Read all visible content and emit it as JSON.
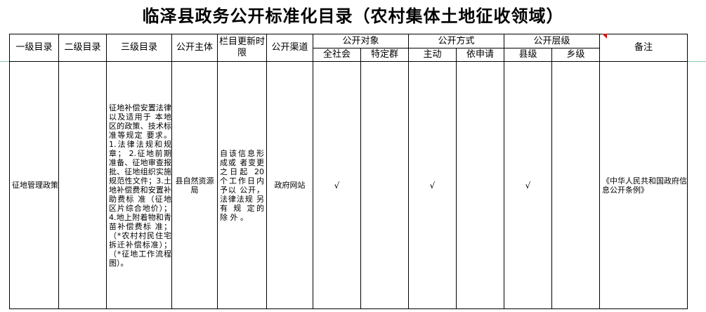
{
  "title": "临泽县政务公开标准化目录（农村集体土地征收领域）",
  "headers": {
    "level1": "一级目录",
    "level2": "二级目录",
    "level3": "三级目录",
    "subject": "公开主体",
    "update": "栏目更新时限",
    "channel": "公开渠道",
    "target": "公开对象",
    "target_all": "全社会",
    "target_specific": "特定群",
    "method": "公开方式",
    "method_active": "主动",
    "method_request": "依申请",
    "tier": "公开层级",
    "tier_county": "县级",
    "tier_town": "乡级",
    "remark": "备注"
  },
  "row": {
    "level1": "征地管理政策",
    "level2": "",
    "level3": "征地补偿安置法律以及适用于 本地区的政策、技术标准等规定 要求。1.法律法规和规章； 2.征地前期准备、征地审查报 批、征地组织实施规范性文件；3.土地补偿费和安置补助费标 准（征地区片综合地价）； 4.地上附着物和青苗补偿费标 准；（*农村村民住宅拆迁补偿标准）； （*征地工作流程图）。",
    "subject": "县自然资源局",
    "update": "自该信息形成或 者变更之日起 20 个工作日内予以 公开，法律法规 另有 规 定的 除 外 。",
    "channel": "政府网站",
    "target_all": "√",
    "target_specific": "",
    "method_active": "√",
    "method_request": "",
    "tier_county": "√",
    "tier_town": "",
    "remark": "《中华人民共和国政府信息公开条例》"
  }
}
